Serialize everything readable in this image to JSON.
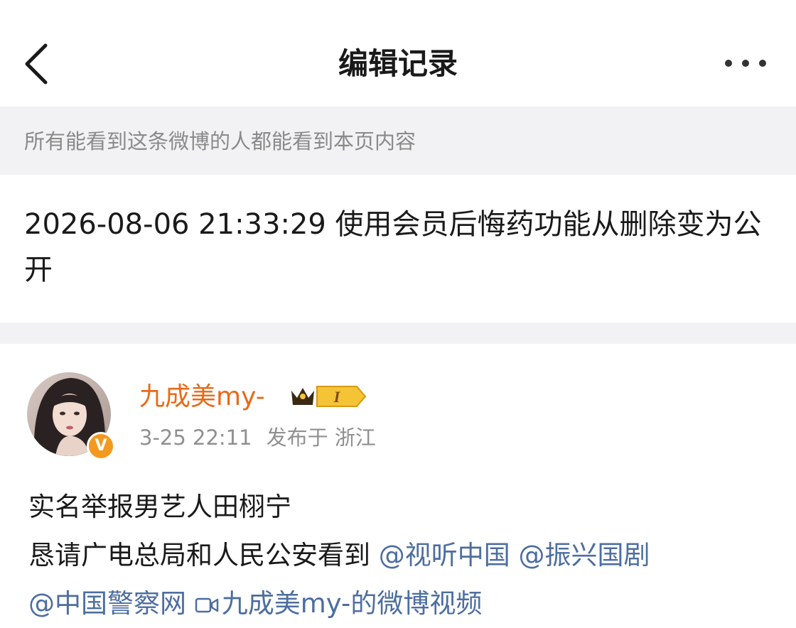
{
  "header": {
    "title": "编辑记录",
    "back_icon": "chevron-left-icon",
    "more_icon": "more-dots-icon"
  },
  "notice": {
    "text": "所有能看到这条微博的人都能看到本页内容"
  },
  "record": {
    "text": "2026-08-06 21:33:29 使用会员后悔药功能从删除变为公开"
  },
  "post": {
    "username": "九成美my-",
    "member_badge_level": "I",
    "verified_badge": "V",
    "time": "3-25 22:11",
    "location": "发布于 浙江",
    "line1": "实名举报男艺人田栩宁",
    "line2_prefix": "恳请广电总局和人民公安看到 ",
    "mention1": "@视听中国",
    "mention2": "@振兴国剧",
    "mention3": "@中国警察网",
    "video_link": "九成美my-的微博视频",
    "colors": {
      "username": "#e86a17",
      "link": "#4d6ea0",
      "badge": "#f39a1e"
    }
  }
}
